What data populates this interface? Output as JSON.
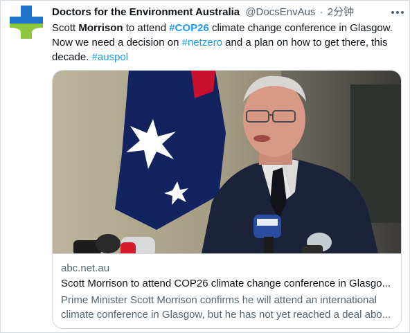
{
  "tweet": {
    "author": {
      "display_name": "Doctors for the Environment Australia",
      "handle": "@DocsEnvAus",
      "avatar_icon": "green-blue-cross-logo-icon"
    },
    "separator": "·",
    "timestamp": "2分钟",
    "more_icon": "more-horizontal-icon",
    "text": {
      "line1": {
        "p1": "Scott ",
        "p2": "Morrison",
        "p3": " to attend ",
        "p4": "#COP26",
        "p5": " climate change conference in Glasgow."
      },
      "line2": {
        "p1": "Now we need a decision on ",
        "p2": "#netzero",
        "p3": " and a plan on how to get there, this"
      },
      "line3": {
        "p1": "decade. ",
        "p2": "#auspol"
      }
    },
    "card": {
      "image_desc_icon": "article-photo-icon",
      "domain": "abc.net.au",
      "title": "Scott Morrison to attend COP26 climate change conference in Glasgo...",
      "description_line1": "Prime Minister Scott Morrison confirms he will attend an international",
      "description_line2": "climate conference in Glasgow, but he has not yet reached a deal abo..."
    }
  },
  "colors": {
    "link": "#1d9bf0",
    "secondary_text": "#536471",
    "primary_text": "#0f1419",
    "border": "#cfd9de",
    "logo_blue": "#1f74c7",
    "logo_green": "#8dc63f"
  }
}
